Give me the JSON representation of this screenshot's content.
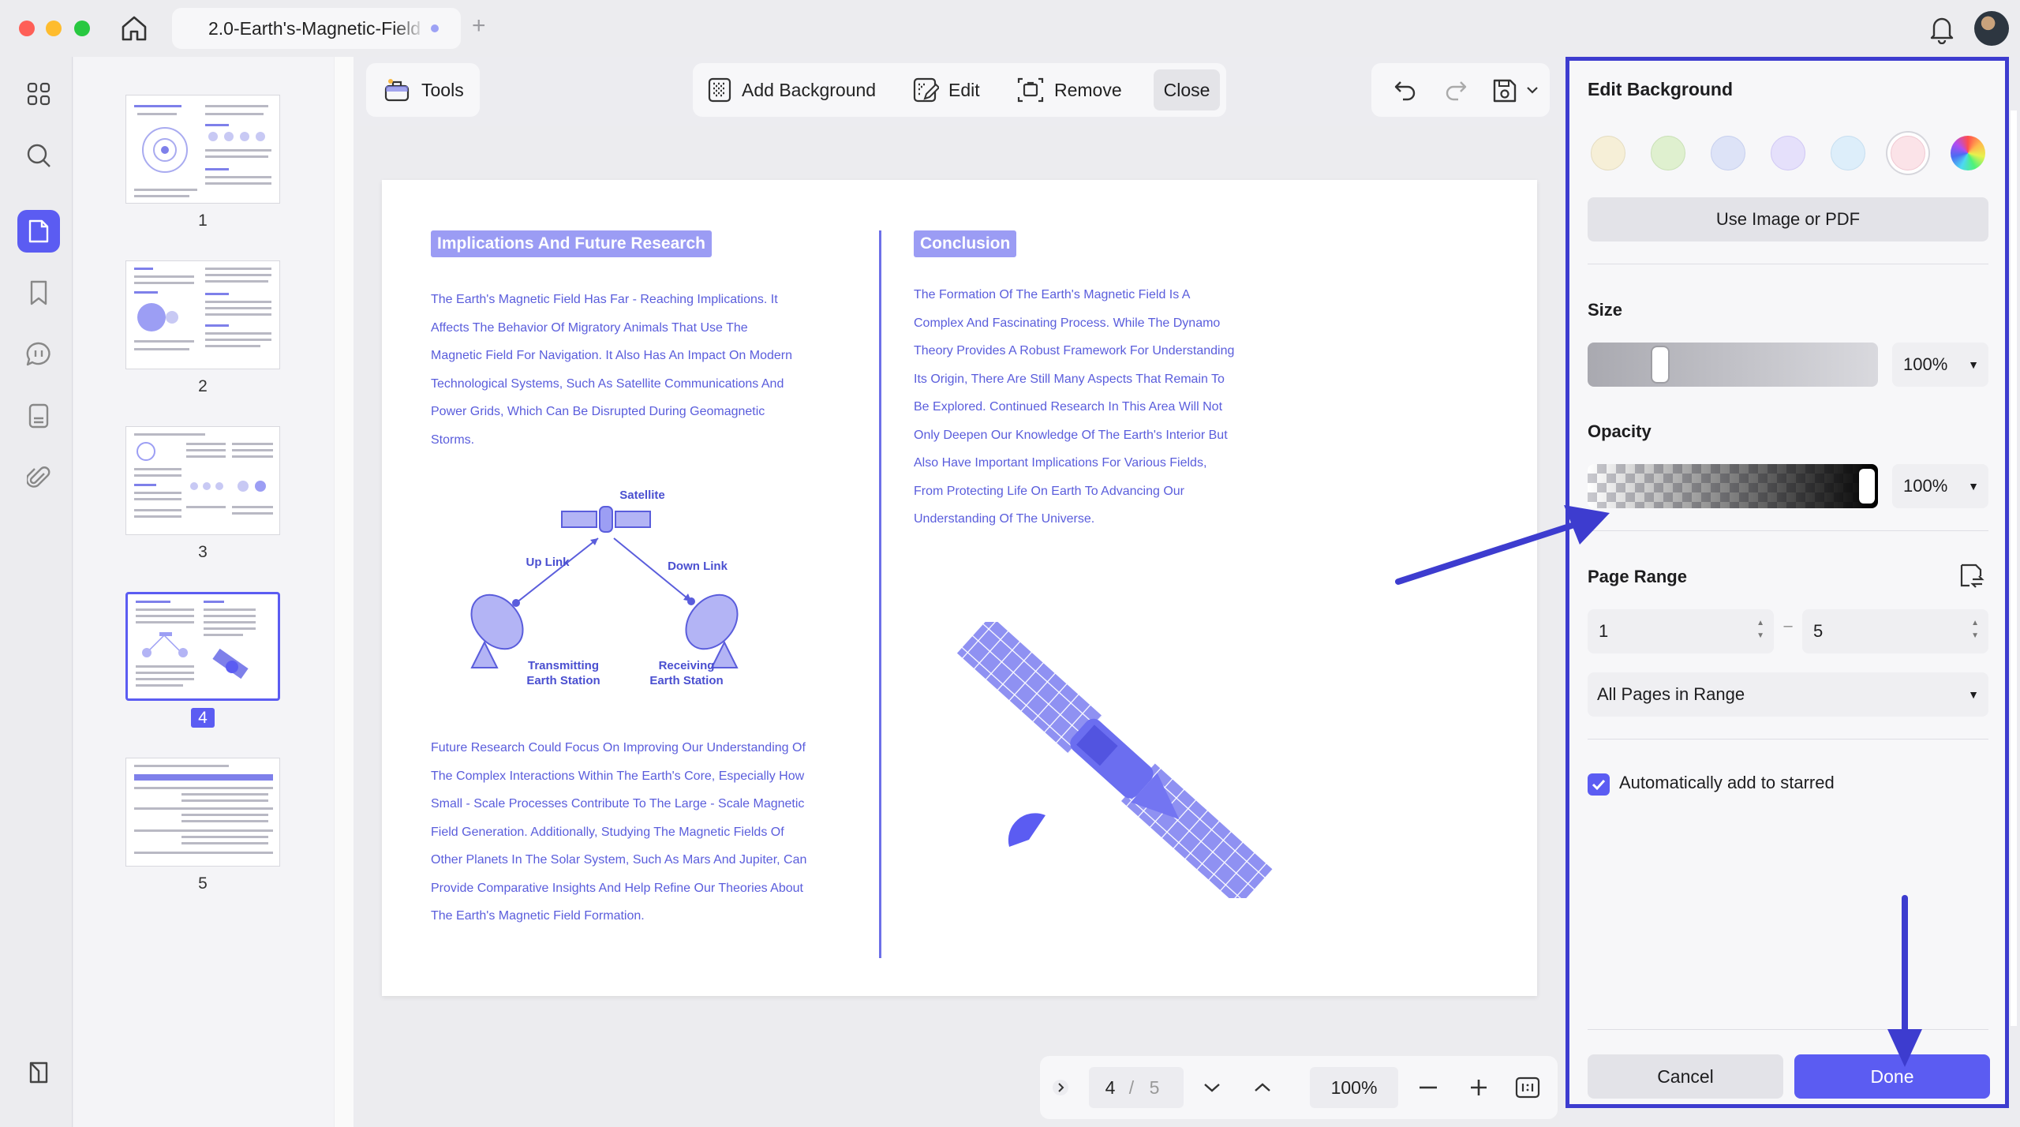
{
  "window": {
    "tab_title": "2.0-Earth's-Magnetic-Field",
    "tab_add": "+"
  },
  "rail": {
    "items": [
      "apps-icon",
      "search-icon",
      "pages-icon",
      "bookmark-icon",
      "comment-icon",
      "form-icon",
      "attachment-icon"
    ]
  },
  "thumbnails": {
    "pages": [
      {
        "number": "1",
        "title": "Formation Of The Earth's Magnetic Field"
      },
      {
        "number": "2",
        "title": ""
      },
      {
        "number": "3",
        "title": "Theories For The Formation"
      },
      {
        "number": "4",
        "title": ""
      },
      {
        "number": "5",
        "title": "Satellite Communication And Power Grids"
      }
    ],
    "selected": "4"
  },
  "toolbar": {
    "tools_label": "Tools",
    "add_background_label": "Add Background",
    "edit_label": "Edit",
    "remove_label": "Remove",
    "close_label": "Close"
  },
  "document": {
    "left_heading": "Implications And Future Research",
    "left_para1_lines": [
      "The Earth's Magnetic Field Has Far - Reaching Implications. It",
      "Affects The Behavior Of Migratory Animals That Use The",
      "Magnetic Field For Navigation. It Also Has An Impact On Modern",
      "Technological Systems, Such As Satellite Communications And",
      "Power Grids, Which Can Be Disrupted During Geomagnetic",
      "Storms."
    ],
    "diagram": {
      "satellite": "Satellite",
      "uplink": "Up Link",
      "downlink": "Down Link",
      "transmitting": "Transmitting\nEarth Station",
      "receiving": "Receiving\nEarth Station"
    },
    "left_para2_lines": [
      "Future Research Could Focus On Improving Our Understanding Of",
      "The Complex Interactions Within The Earth's Core, Especially How",
      "Small - Scale Processes Contribute To The Large - Scale Magnetic",
      "Field Generation. Additionally, Studying The Magnetic Fields Of",
      "Other Planets In The Solar System, Such As Mars And Jupiter, Can",
      "Provide Comparative Insights And Help Refine Our Theories About",
      "The Earth's Magnetic Field Formation."
    ],
    "right_heading": "Conclusion",
    "right_para_lines": [
      "The Formation Of The Earth's Magnetic Field Is A",
      "Complex And Fascinating Process. While The Dynamo",
      "Theory Provides A Robust Framework For Understanding",
      "Its Origin, There Are Still Many Aspects That Remain To",
      "Be Explored. Continued Research In This Area Will Not",
      "Only Deepen Our Knowledge Of The Earth's Interior But",
      "Also Have Important Implications For Various Fields,",
      "From Protecting Life On Earth To Advancing Our",
      "Understanding Of The Universe."
    ]
  },
  "pagenav": {
    "current_page": "4",
    "separator": "/",
    "total_pages": "5",
    "zoom": "100%"
  },
  "panel": {
    "title": "Edit Background",
    "swatches": [
      {
        "name": "cream",
        "color": "#f6efd7"
      },
      {
        "name": "green",
        "color": "#dff0cf"
      },
      {
        "name": "blue",
        "color": "#dde3f7"
      },
      {
        "name": "lavender",
        "color": "#e5e0fb"
      },
      {
        "name": "sky",
        "color": "#ddeefa"
      },
      {
        "name": "pink",
        "color": "#fbe3e8"
      },
      {
        "name": "custom",
        "color": "conic"
      }
    ],
    "selected_swatch": "pink",
    "use_image_label": "Use Image or PDF",
    "size_label": "Size",
    "size_value": "100%",
    "opacity_label": "Opacity",
    "opacity_value": "100%",
    "page_range_label": "Page Range",
    "range_from": "1",
    "range_dash": "–",
    "range_to": "5",
    "range_mode": "All Pages in Range",
    "auto_star_label": "Automatically add to starred",
    "auto_star_checked": true,
    "cancel_label": "Cancel",
    "done_label": "Done"
  },
  "colors": {
    "accent": "#5b5cf2",
    "doc_text": "#5a5ddc",
    "annotation": "#3d3ccf"
  }
}
